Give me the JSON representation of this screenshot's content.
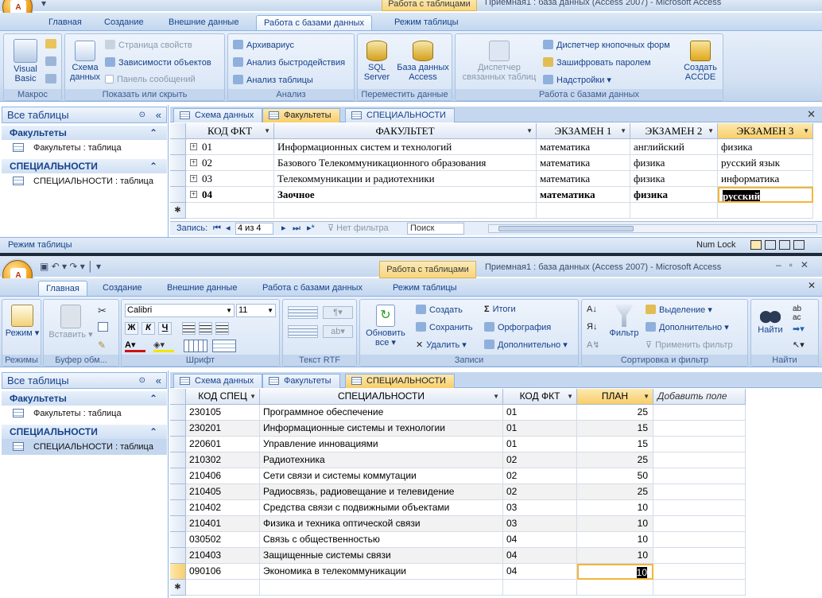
{
  "win1": {
    "title": "Приемная1 : база данных (Access 2007) - Microsoft Access",
    "context_tab": "Работа с таблицами",
    "tabs": [
      "Главная",
      "Создание",
      "Внешние данные",
      "Работа с базами данных",
      "Режим таблицы"
    ],
    "ribbon": {
      "macro": {
        "visual_basic": "Visual Basic",
        "label": "Макрос"
      },
      "show": {
        "schema": "Схема данных",
        "props": "Страница свойств",
        "deps": "Зависимости объектов",
        "msgbar": "Панель сообщений",
        "label": "Показать или скрыть"
      },
      "analysis": {
        "archivist": "Архивариус",
        "perf": "Анализ быстродействия",
        "table": "Анализ таблицы",
        "label": "Анализ"
      },
      "move": {
        "sql": "SQL Server",
        "db": "База данных Access",
        "label": "Переместить данные"
      },
      "dbtools": {
        "switchboard_dim": "Диспетчер связанных таблиц",
        "switchboard": "Диспетчер кнопочных форм",
        "encrypt": "Зашифровать паролем",
        "addins": "Надстройки",
        "accde": "Создать ACCDE",
        "label": "Работа с базами данных"
      }
    },
    "nav": {
      "header": "Все таблицы",
      "g1": "Факультеты",
      "g1_item": "Факультеты : таблица",
      "g2": "СПЕЦИАЛЬНОСТИ",
      "g2_item": "СПЕЦИАЛЬНОСТИ : таблица"
    },
    "doc_tabs": [
      "Схема данных",
      "Факультеты",
      "СПЕЦИАЛЬНОСТИ"
    ],
    "columns": [
      "КОД ФКТ",
      "ФАКУЛЬТЕТ",
      "ЭКЗАМЕН 1",
      "ЭКЗАМЕН 2",
      "ЭКЗАМЕН 3"
    ],
    "rows": [
      [
        "01",
        "Информационных систем и технологий",
        "математика",
        "английский",
        "физика"
      ],
      [
        "02",
        "Базового Телекоммуникационного образования",
        "математика",
        "физика",
        "русский язык"
      ],
      [
        "03",
        "Телекоммуникации и радиотехники",
        "математика",
        "физика",
        "информатика"
      ],
      [
        "04",
        "Заочное",
        "математика",
        "физика",
        "русский"
      ]
    ],
    "record": {
      "label": "Запись:",
      "pos": "4 из 4",
      "nofilter": "Нет фильтра",
      "search": "Поиск"
    },
    "status": {
      "left": "Режим таблицы",
      "numlock": "Num Lock"
    }
  },
  "win2": {
    "title": "Приемная1 : база данных (Access 2007) - Microsoft Access",
    "context_tab": "Работа с таблицами",
    "tabs": [
      "Главная",
      "Создание",
      "Внешние данные",
      "Работа с базами данных",
      "Режим таблицы"
    ],
    "ribbon": {
      "views": {
        "mode": "Режим",
        "label": "Режимы"
      },
      "clipboard": {
        "paste": "Вставить",
        "label": "Буфер обм..."
      },
      "font": {
        "name": "Calibri",
        "size": "11",
        "label": "Шрифт"
      },
      "rtf": {
        "label": "Текст RTF"
      },
      "records": {
        "refresh": "Обновить все",
        "create": "Создать",
        "save": "Сохранить",
        "delete": "Удалить",
        "totals": "Итоги",
        "spelling": "Орфография",
        "more": "Дополнительно",
        "label": "Записи"
      },
      "sort": {
        "filter": "Фильтр",
        "selection": "Выделение",
        "advanced": "Дополнительно",
        "apply": "Применить фильтр",
        "label": "Сортировка и фильтр"
      },
      "find": {
        "find": "Найти",
        "label": "Найти"
      }
    },
    "nav": {
      "header": "Все таблицы",
      "g1": "Факультеты",
      "g1_item": "Факультеты : таблица",
      "g2": "СПЕЦИАЛЬНОСТИ",
      "g2_item": "СПЕЦИАЛЬНОСТИ : таблица"
    },
    "doc_tabs": [
      "Схема данных",
      "Факультеты",
      "СПЕЦИАЛЬНОСТИ"
    ],
    "columns": [
      "КОД СПЕЦ",
      "СПЕЦИАЛЬНОСТИ",
      "КОД ФКТ",
      "ПЛАН",
      "Добавить поле"
    ],
    "rows": [
      [
        "230105",
        "Программное обеспечение",
        "01",
        "25"
      ],
      [
        "230201",
        "Информационные системы и технологии",
        "01",
        "15"
      ],
      [
        "220601",
        "Управление инновациями",
        "01",
        "15"
      ],
      [
        "210302",
        "Радиотехника",
        "02",
        "25"
      ],
      [
        "210406",
        "Сети связи и системы коммутации",
        "02",
        "50"
      ],
      [
        "210405",
        "Радиосвязь, радиовещание и телевидение",
        "02",
        "25"
      ],
      [
        "210402",
        "Средства связи с подвижными объектами",
        "03",
        "10"
      ],
      [
        "210401",
        "Физика и техника оптической связи",
        "03",
        "10"
      ],
      [
        "030502",
        "Связь с общественностью",
        "04",
        "10"
      ],
      [
        "210403",
        "Защищенные системы связи",
        "04",
        "10"
      ],
      [
        "090106",
        "Экономика в телекоммуникации",
        "04",
        "10"
      ]
    ]
  },
  "colors": {
    "accent": "#15428b",
    "ribbon": "#d3e1f2",
    "active_tab": "#f8ce6a",
    "selection": "#000000"
  }
}
